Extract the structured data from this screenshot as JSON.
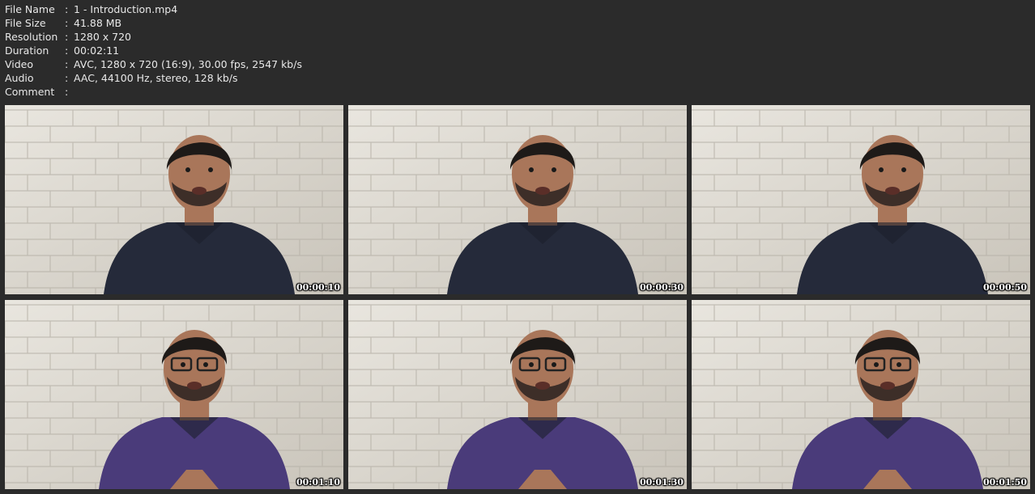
{
  "info": [
    {
      "key": "File Name",
      "sep": ":",
      "value": "1 - Introduction.mp4"
    },
    {
      "key": "File Size",
      "sep": ":",
      "value": "41.88 MB"
    },
    {
      "key": "Resolution",
      "sep": ":",
      "value": "1280 x 720"
    },
    {
      "key": "Duration",
      "sep": ":",
      "value": "00:02:11"
    },
    {
      "key": "Video",
      "sep": ":",
      "value": "AVC, 1280 x 720 (16:9), 30.00 fps, 2547 kb/s"
    },
    {
      "key": "Audio",
      "sep": ":",
      "value": "AAC, 44100 Hz, stereo, 128 kb/s"
    },
    {
      "key": "Comment",
      "sep": ":",
      "value": ""
    }
  ],
  "thumbnails": [
    {
      "timestamp": "00:00:10",
      "presenter": "presenter-1",
      "shirt_color": "#252a3a"
    },
    {
      "timestamp": "00:00:30",
      "presenter": "presenter-1",
      "shirt_color": "#252a3a"
    },
    {
      "timestamp": "00:00:50",
      "presenter": "presenter-1",
      "shirt_color": "#252a3a"
    },
    {
      "timestamp": "00:01:10",
      "presenter": "presenter-2",
      "shirt_color": "#4a3b7a"
    },
    {
      "timestamp": "00:01:30",
      "presenter": "presenter-2",
      "shirt_color": "#4a3b7a"
    },
    {
      "timestamp": "00:01:50",
      "presenter": "presenter-2",
      "shirt_color": "#4a3b7a"
    }
  ],
  "colors": {
    "background": "#2b2b2b",
    "text": "#e8e8e8",
    "brick_wall": "#d9d5cd",
    "mortar": "#b9b4aa",
    "skin": "#a9765a"
  }
}
